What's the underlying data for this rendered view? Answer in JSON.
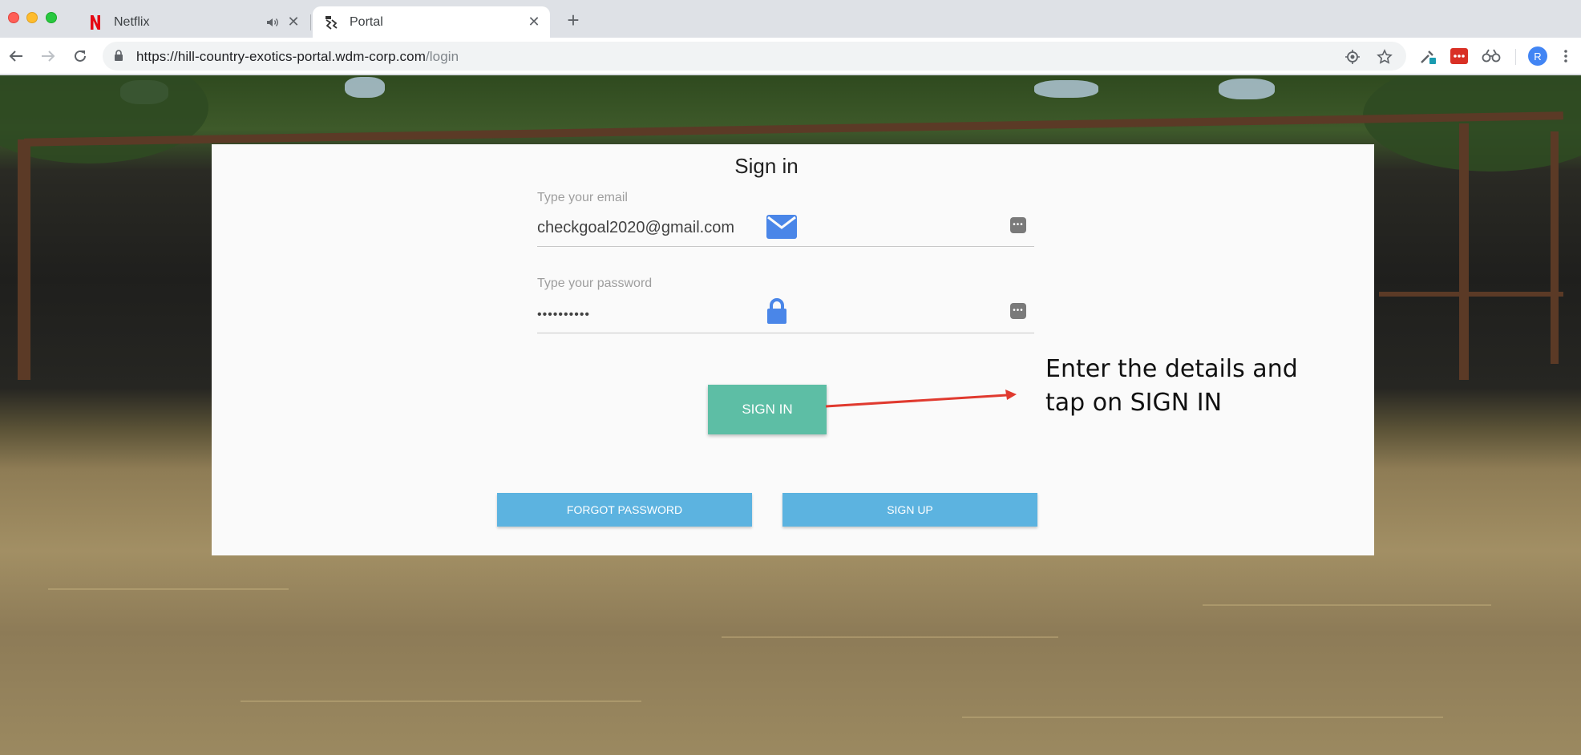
{
  "browser": {
    "tabs": [
      {
        "title": "Netflix",
        "favicon": "netflix-n-icon",
        "audio": "speaker-icon"
      },
      {
        "title": "Portal",
        "favicon": "portal-logo-icon",
        "active": true
      }
    ],
    "url": {
      "host": "https://hill-country-exotics-portal.wdm-corp.com",
      "path": "/login"
    },
    "avatar_letter": "R"
  },
  "login": {
    "title": "Sign in",
    "email": {
      "label": "Type your email",
      "value": "checkgoal2020@gmail.com"
    },
    "password": {
      "label": "Type your password",
      "value": "••••••••••"
    },
    "signin_label": "SIGN IN",
    "forgot_label": "FORGOT PASSWORD",
    "signup_label": "SIGN UP"
  },
  "annotation": {
    "text_line1": "Enter the details and",
    "text_line2": "tap on SIGN IN",
    "arrow_color": "#e03a2f"
  },
  "colors": {
    "signin_button": "#5dbea5",
    "secondary_buttons": "#5cb3e0",
    "field_icons": "#4a86e8"
  }
}
